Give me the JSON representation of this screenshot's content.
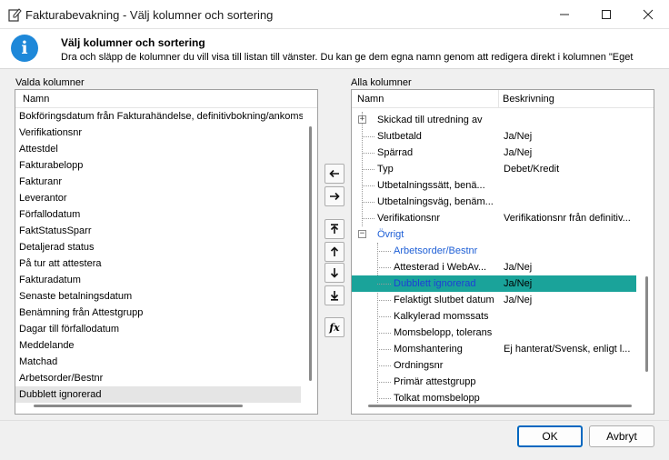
{
  "window": {
    "title": "Fakturabevakning - Välj kolumner och sortering",
    "icon": "edit-document-icon"
  },
  "header": {
    "title": "Välj kolumner och sortering",
    "description": "Dra och släpp de kolumner du vill visa till listan till vänster. Du kan ge dem egna namn genom att redigera direkt i kolumnen \"Eget",
    "icon": "info-icon"
  },
  "left_panel": {
    "label": "Valda kolumner",
    "column_header": "Namn",
    "items": [
      "Bokföringsdatum från Fakturahändelse, definitivbokning/ankomst",
      "Verifikationsnr",
      "Attestdel",
      "Fakturabelopp",
      "Fakturanr",
      "Leverantor",
      "Förfallodatum",
      "FaktStatusSparr",
      "Detaljerad status",
      "På tur att attestera",
      "Fakturadatum",
      "Senaste betalningsdatum",
      "Benämning från Attestgrupp",
      "Dagar till förfallodatum",
      "Meddelande",
      "Matchad",
      "Arbetsorder/Bestnr",
      "Dubblett ignorerad"
    ],
    "selected_index": 17
  },
  "right_panel": {
    "label": "Alla kolumner",
    "columns": [
      "Namn",
      "Beskrivning"
    ],
    "rows": [
      {
        "name": "Skickad till utredning av",
        "desc": "",
        "level": 0,
        "expander": "+"
      },
      {
        "name": "Slutbetald",
        "desc": "Ja/Nej",
        "level": 1
      },
      {
        "name": "Spärrad",
        "desc": "Ja/Nej",
        "level": 1
      },
      {
        "name": "Typ",
        "desc": "Debet/Kredit",
        "level": 1
      },
      {
        "name": "Utbetalningssätt, benä...",
        "desc": "",
        "level": 1
      },
      {
        "name": "Utbetalningsväg, benäm...",
        "desc": "",
        "level": 1
      },
      {
        "name": "Verifikationsnr",
        "desc": "Verifikationsnr från definitiv...",
        "level": 1
      },
      {
        "name": "Övrigt",
        "desc": "",
        "level": 0,
        "expander": "−",
        "style": "blue"
      },
      {
        "name": "Arbetsorder/Bestnr",
        "desc": "",
        "level": 2,
        "style": "blue"
      },
      {
        "name": "Attesterad i WebAv...",
        "desc": "Ja/Nej",
        "level": 2
      },
      {
        "name": "Dubblett ignorerad",
        "desc": "Ja/Nej",
        "level": 2,
        "style": "highlight"
      },
      {
        "name": "Felaktigt slutbet datum",
        "desc": "Ja/Nej",
        "level": 2
      },
      {
        "name": "Kalkylerad momssats",
        "desc": "",
        "level": 2
      },
      {
        "name": "Momsbelopp, tolerans",
        "desc": "",
        "level": 2
      },
      {
        "name": "Momshantering",
        "desc": "Ej hanterat/Svensk, enligt l...",
        "level": 2
      },
      {
        "name": "Ordningsnr",
        "desc": "",
        "level": 2
      },
      {
        "name": "Primär attestgrupp",
        "desc": "",
        "level": 2
      },
      {
        "name": "Tolkat momsbelopp",
        "desc": "",
        "level": 2
      }
    ]
  },
  "mid_buttons": [
    {
      "name": "move-left-button",
      "icon": "arrow-left-icon"
    },
    {
      "name": "move-right-button",
      "icon": "arrow-right-icon"
    },
    {
      "name": "move-top-button",
      "icon": "arrow-to-top-icon"
    },
    {
      "name": "move-up-button",
      "icon": "arrow-up-icon"
    },
    {
      "name": "move-down-button",
      "icon": "arrow-down-icon"
    },
    {
      "name": "move-bottom-button",
      "icon": "arrow-to-bottom-icon"
    },
    {
      "name": "formula-button",
      "icon": "function-fx-icon",
      "label": "fx"
    }
  ],
  "footer": {
    "ok_label": "OK",
    "cancel_label": "Avbryt"
  },
  "colors": {
    "highlight": "#1aa39a",
    "link_blue": "#1e5fd6",
    "info_blue": "#1e88d9",
    "primary_border": "#0067c0"
  }
}
